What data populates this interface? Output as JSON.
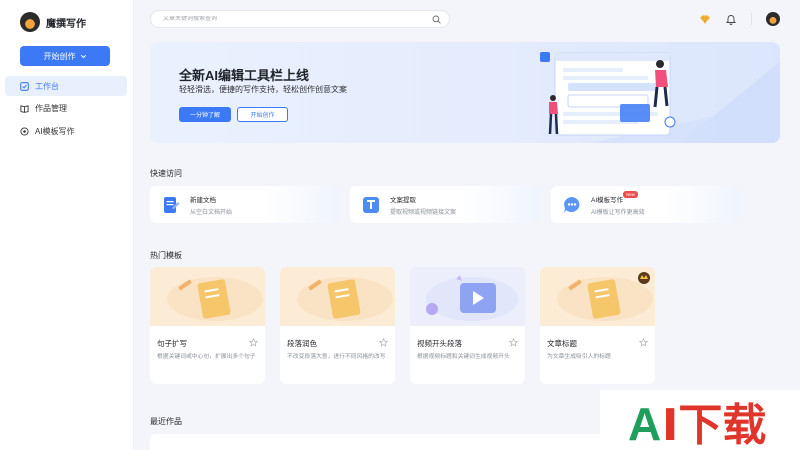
{
  "app": {
    "name": "魔撰写作"
  },
  "sidebar": {
    "start_label": "开始创作",
    "items": [
      {
        "label": "工作台",
        "icon": "workbench-icon",
        "active": true
      },
      {
        "label": "作品管理",
        "icon": "works-icon",
        "active": false
      },
      {
        "label": "AI模板写作",
        "icon": "ai-template-icon",
        "active": false
      }
    ]
  },
  "header": {
    "search_placeholder": "文章关键词搜索查询"
  },
  "banner": {
    "title": "全新AI编辑工具栏上线",
    "subtitle": "轻轻滑选，便捷的写作支持，轻松创作创意文案",
    "primary_label": "一分钟了解",
    "secondary_label": "开始创作"
  },
  "quick_access": {
    "title": "快速访问",
    "items": [
      {
        "title": "新建文档",
        "desc": "从空白文档开始",
        "icon": "new-doc-icon",
        "color": "#3c7af5"
      },
      {
        "title": "文案提取",
        "desc": "提取视频或视频链接文案",
        "icon": "text-extract-icon",
        "color": "#4b8cf7"
      },
      {
        "title": "AI模板写作",
        "desc": "AI模板让写作更高效",
        "icon": "ai-writing-icon",
        "color": "#5b95f6",
        "badge": "New"
      }
    ]
  },
  "templates": {
    "title": "热门模板",
    "items": [
      {
        "name": "句子扩写",
        "desc": "根据关键词或中心句，扩展出多个句子"
      },
      {
        "name": "段落润色",
        "desc": "不改变段落大意，进行不同风格的改写"
      },
      {
        "name": "视频开头段落",
        "desc": "根据视频标题和关键词生成视频开头"
      },
      {
        "name": "文章标题",
        "desc": "为文章生成吸引人的标题"
      }
    ]
  },
  "recent": {
    "title": "最近作品"
  },
  "watermark": {
    "text_a": "A",
    "text_b": "I下载"
  },
  "colors": {
    "accent": "#3c7af5",
    "badge": "#f04a4a",
    "watermark_green": "#1e9e5a",
    "watermark_red": "#e0352b"
  }
}
